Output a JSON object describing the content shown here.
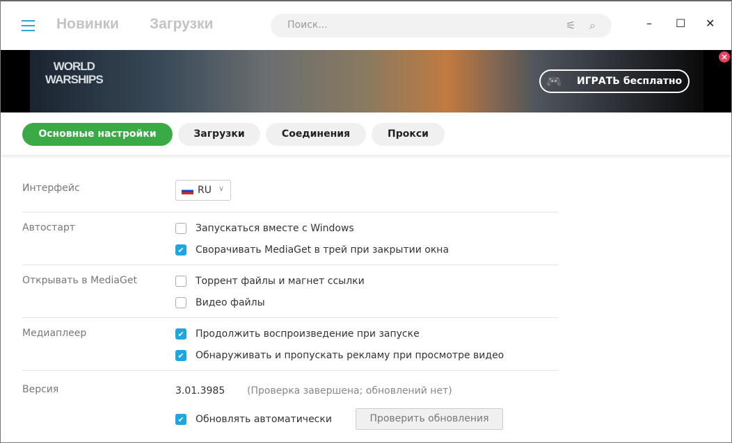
{
  "header": {
    "nav": [
      "Новинки",
      "Загрузки"
    ],
    "search_placeholder": "Поиск...",
    "minimize": "–",
    "maximize": "☐",
    "close": "✕"
  },
  "banner": {
    "logo_line1": "WORLD",
    "logo_line2": "WARSHIPS",
    "play": "ИГРАТЬ бесплатно",
    "close": "×"
  },
  "tabs": [
    "Основные настройки",
    "Загрузки",
    "Соединения",
    "Прокси"
  ],
  "settings": {
    "interface_label": "Интерфейс",
    "language": "RU",
    "autostart_label": "Автостарт",
    "autostart": [
      "Запускаться вместе с Windows",
      "Сворачивать MediaGet в трей при закрытии окна"
    ],
    "open_label": "Открывать в MediaGet",
    "open": [
      "Торрент файлы и магнет ссылки",
      "Видео файлы"
    ],
    "player_label": "Медиаплеер",
    "player": [
      "Продолжить воспроизведение при запуске",
      "Обнаруживать и пропускать рекламу при просмотре видео"
    ],
    "version_label": "Версия",
    "version": "3.01.3985",
    "version_status": "(Проверка завершена; обновлений нет)",
    "auto_update": "Обновлять автоматически",
    "check_updates": "Проверить обновления"
  }
}
